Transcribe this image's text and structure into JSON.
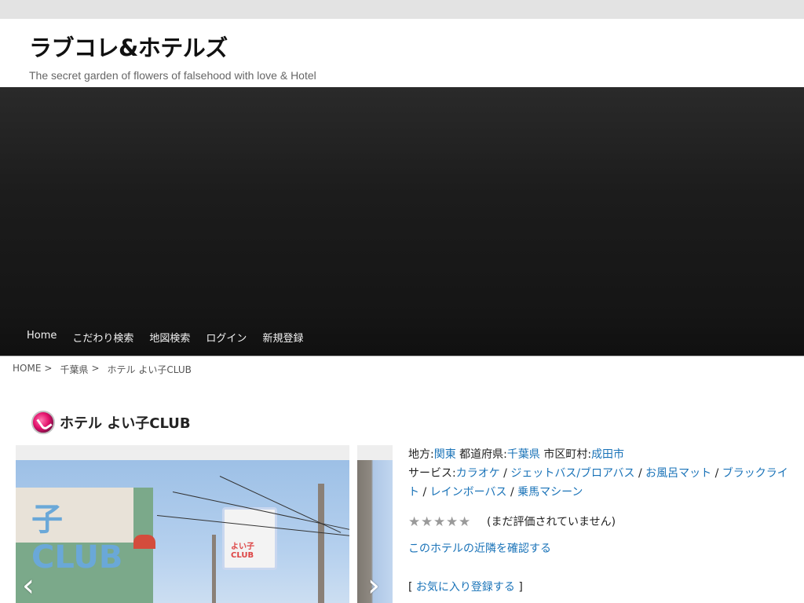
{
  "header": {
    "title": "ラブコレ&ホテルズ",
    "description": "The secret garden of flowers of falsehood with love & Hotel"
  },
  "nav": {
    "items": [
      "Home",
      "こだわり検索",
      "地図検索",
      "ログイン",
      "新規登録"
    ]
  },
  "breadcrumb": {
    "home": "HOME",
    "pref": "千葉県",
    "current": "ホテル よい子CLUB",
    "separator": ">"
  },
  "hotel": {
    "name": "ホテル よい子CLUB",
    "region_label": "地方:",
    "region": "関東",
    "pref_label": "都道府県:",
    "pref": "千葉県",
    "city_label": "市区町村:",
    "city": "成田市",
    "services_label": "サービス:",
    "services": [
      "カラオケ",
      "ジェットバス/ブロアバス",
      "お風呂マット",
      "ブラックライト",
      "レインボーバス",
      "乗馬マシーン"
    ],
    "rating_text": "(まだ評価されていません)",
    "rating_value": 0,
    "rating_max": 5,
    "nearby_link": "このホテルの近隣を確認する",
    "favorite_open": "[",
    "favorite_link": "お気に入り登録する",
    "favorite_close": "]"
  },
  "gallery": {
    "sign_text": "子CLUB",
    "board_text": "よい子CLUB",
    "prev_icon": "‹",
    "next_icon": "›"
  },
  "colors": {
    "link": "#1a73b8",
    "topbar": "#e3e3e3",
    "hero": "#1c1c1c"
  }
}
